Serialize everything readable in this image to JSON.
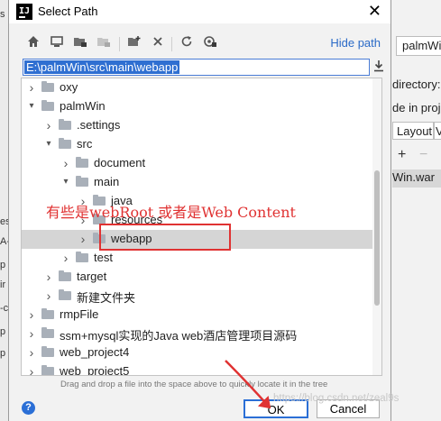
{
  "dialog": {
    "title": "Select Path",
    "app_icon_text": "IJ",
    "close_glyph": "✕",
    "hide_path_label": "Hide path",
    "path_value": "E:\\palmWin\\src\\main\\webapp",
    "drop_hint": "Drag and drop a file into the space above to quickly locate it in the tree",
    "ok_label": "OK",
    "cancel_label": "Cancel",
    "help_glyph": "?"
  },
  "toolbar_icons": [
    "home-icon",
    "desktop-icon",
    "project-folder-icon",
    "module-folder-icon",
    "new-folder-icon",
    "delete-icon",
    "refresh-icon",
    "show-hidden-icon"
  ],
  "tree": {
    "rows": [
      {
        "label": "oxy",
        "expanded": false,
        "depth": 0
      },
      {
        "label": "palmWin",
        "expanded": true,
        "depth": 0
      },
      {
        "label": ".settings",
        "expanded": false,
        "depth": 1
      },
      {
        "label": "src",
        "expanded": true,
        "depth": 1
      },
      {
        "label": "document",
        "expanded": false,
        "depth": 2
      },
      {
        "label": "main",
        "expanded": true,
        "depth": 2
      },
      {
        "label": "java",
        "expanded": false,
        "depth": 3
      },
      {
        "label": "resources",
        "expanded": false,
        "depth": 3
      },
      {
        "label": "webapp",
        "expanded": false,
        "depth": 3,
        "selected": true
      },
      {
        "label": "test",
        "expanded": false,
        "depth": 2
      },
      {
        "label": "target",
        "expanded": false,
        "depth": 1
      },
      {
        "label": "新建文件夹",
        "expanded": false,
        "depth": 1
      },
      {
        "label": "rmpFile",
        "expanded": false,
        "depth": 0
      },
      {
        "label": "ssm+mysql实现的Java web酒店管理项目源码",
        "expanded": false,
        "depth": 0
      },
      {
        "label": "web_project4",
        "expanded": false,
        "depth": 0
      },
      {
        "label": "web_project5",
        "expanded": false,
        "depth": 0
      }
    ]
  },
  "annotation": {
    "text": "有些是webRoot 或者是Web Content",
    "color": "#e03232"
  },
  "watermark": "https://blog.csdn.net/zeal9s",
  "background": {
    "field_value": "palmWi",
    "label_directory": "directory:",
    "label_in_proj": "de in proj",
    "tab_layout": "Layout",
    "tab_other": "V",
    "artifact": "Win.war",
    "add_glyph": "+",
    "remove_glyph": "−"
  },
  "colors": {
    "accent": "#2b6fd6",
    "selection": "#d5d5d5",
    "annotation": "#e03232"
  }
}
